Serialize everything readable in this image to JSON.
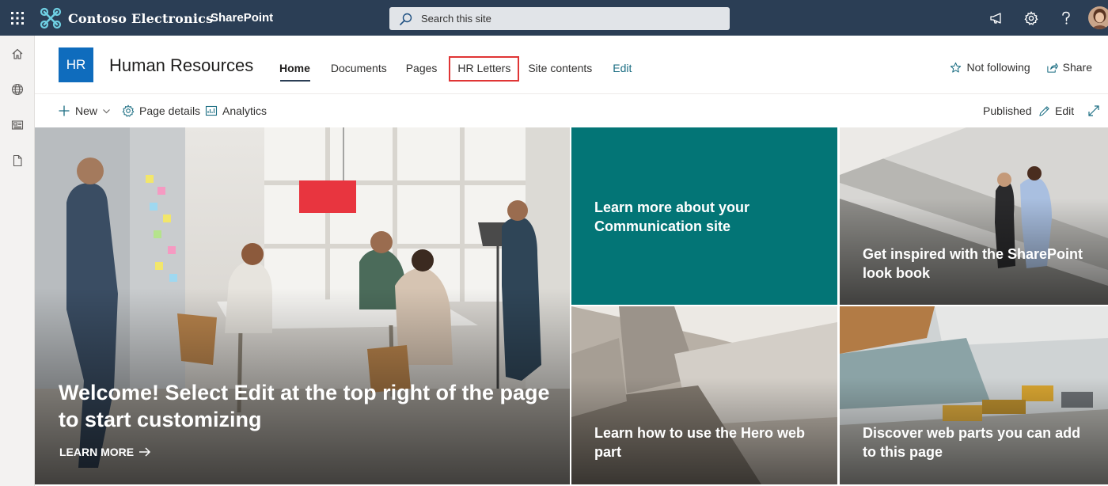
{
  "suitebar": {
    "brand_name": "Contoso Electronics",
    "app_name": "SharePoint",
    "search_placeholder": "Search this site"
  },
  "site": {
    "logo_text": "HR",
    "title": "Human Resources",
    "nav": [
      {
        "label": "Home"
      },
      {
        "label": "Documents"
      },
      {
        "label": "Pages"
      },
      {
        "label": "HR Letters"
      },
      {
        "label": "Site contents"
      },
      {
        "label": "Edit"
      }
    ],
    "actions": {
      "follow": "Not following",
      "share": "Share"
    }
  },
  "commands": {
    "new": "New",
    "page_details": "Page details",
    "analytics": "Analytics",
    "status": "Published",
    "edit": "Edit"
  },
  "hero": {
    "main": {
      "title": "Welcome! Select Edit at the top right of the page to start customizing",
      "link": "LEARN MORE"
    },
    "tiles": [
      {
        "title": "Learn more about your Communication site"
      },
      {
        "title": "Get inspired with the SharePoint look book"
      },
      {
        "title": "Learn how to use the Hero web part"
      },
      {
        "title": "Discover web parts you can add to this page"
      }
    ]
  },
  "colors": {
    "suite_bar": "#2b3e55",
    "site_logo": "#0f6cbd",
    "teal_tile": "#037576",
    "nav_highlight": "#e03535"
  }
}
